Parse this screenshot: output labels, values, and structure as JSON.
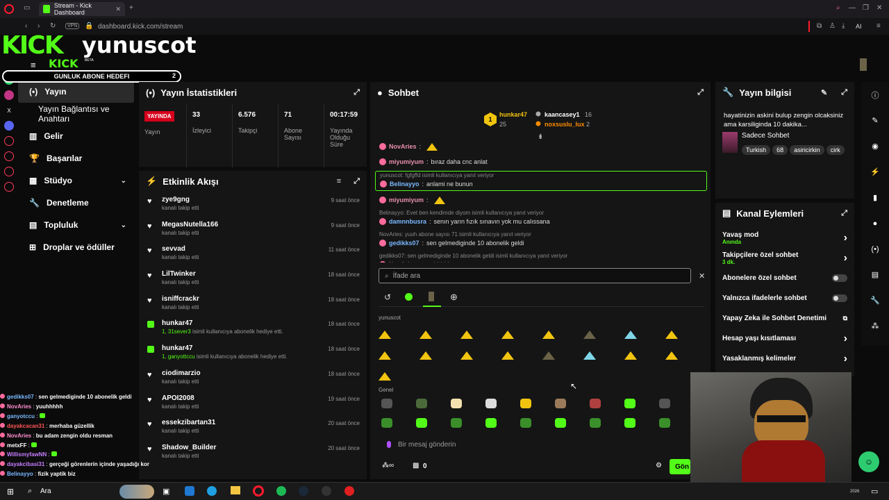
{
  "browser": {
    "tab_title": "Stream - Kick Dashboard",
    "new_tab": "+",
    "vpn": "VPN",
    "url": "dashboard.kick.com/stream",
    "ai_label": "AI"
  },
  "overlay": {
    "logo": "KICK",
    "logo_small": "KICK",
    "beta": "BETA",
    "username": "yunuscot",
    "goal_label": "GUNLUK ABONE HEDEFI",
    "goal_count": "2"
  },
  "nav": {
    "items": [
      {
        "label": "Yayın",
        "icon": "broadcast-icon"
      },
      {
        "label": "Yayın Bağlantısı ve Anahtarı",
        "icon": ""
      },
      {
        "label": "Gelir",
        "icon": "chart-icon"
      },
      {
        "label": "Başarılar",
        "icon": "trophy-icon"
      },
      {
        "label": "Stüdyo",
        "icon": "studio-icon"
      },
      {
        "label": "Denetleme",
        "icon": "wrench-icon"
      },
      {
        "label": "Topluluk",
        "icon": "community-icon"
      },
      {
        "label": "Droplar ve ödüller",
        "icon": "drops-icon"
      }
    ]
  },
  "stats": {
    "title": "Yayın İstatistikleri",
    "live_badge": "YAYINDA",
    "live_label": "Yayın",
    "cells": [
      {
        "value": "33",
        "label": "İzleyici"
      },
      {
        "value": "6.576",
        "label": "Takipçi"
      },
      {
        "value": "71",
        "label": "Abone Sayısı"
      },
      {
        "value": "00:17:59",
        "label": "Yayında Olduğu Süre"
      }
    ]
  },
  "activity": {
    "title": "Etkinlik Akışı",
    "items": [
      {
        "name": "zye9gng",
        "action": "kanalı takip etti",
        "time": "9 saat önce",
        "type": "follow"
      },
      {
        "name": "MegasNutella166",
        "action": "kanalı takip etti",
        "time": "9 saat önce",
        "type": "follow"
      },
      {
        "name": "sevvad",
        "action": "kanalı takip etti",
        "time": "11 saat önce",
        "type": "follow"
      },
      {
        "name": "LilTwinker",
        "action": "kanalı takip etti",
        "time": "18 saat önce",
        "type": "follow"
      },
      {
        "name": "isniffcrackr",
        "action": "kanalı takip etti",
        "time": "18 saat önce",
        "type": "follow"
      },
      {
        "name": "hunkar47",
        "gift_target": "1, 31sever3",
        "action": "isimli kullanıcıya abonelik hediye etti.",
        "time": "18 saat önce",
        "type": "gift"
      },
      {
        "name": "hunkar47",
        "gift_target": "1, ganyottccu",
        "action": "isimli kullanıcıya abonelik hediye etti.",
        "time": "18 saat önce",
        "type": "gift"
      },
      {
        "name": "ciodimarzio",
        "action": "kanalı takip etti",
        "time": "18 saat önce",
        "type": "follow"
      },
      {
        "name": "APOI2008",
        "action": "kanalı takip etti",
        "time": "19 saat önce",
        "type": "follow"
      },
      {
        "name": "essekzibartan31",
        "action": "kanalı takip etti",
        "time": "20 saat önce",
        "type": "follow"
      },
      {
        "name": "Shadow_Builder",
        "action": "kanalı takip etti",
        "time": "20 saat önce",
        "type": "follow"
      }
    ]
  },
  "chat": {
    "title": "Sohbet",
    "top_gifters": [
      {
        "rank": "1",
        "name": "hunkar47",
        "count": "25"
      },
      {
        "name": "kaancasey1",
        "count": "16"
      },
      {
        "name": "noxsuslu_lux",
        "count": "2"
      }
    ],
    "messages": [
      {
        "user": "NovAries",
        "text": "",
        "color": "#e88fb0",
        "reply": ""
      },
      {
        "user": "miyumiyum",
        "text": "bıraz daha cnc anlat",
        "color": "#e88fb0",
        "reply": ""
      },
      {
        "user": "Belinayyo",
        "text": "anlami ne bunun",
        "color": "#7ab8ff",
        "reply": "yunuscot: fgfgffd isimli kullanıcıya yanıt veriyor",
        "highlight": true
      },
      {
        "user": "miyumiyum",
        "text": "",
        "color": "#e88fb0",
        "reply": ""
      },
      {
        "user": "damnnbusra",
        "text": "senın yarın fızık sınavın yok mu calıssana",
        "color": "#7ab8ff",
        "reply": "Belinayyo: Evet ben kendimde diyom isimli kullanıcıya yanıt veriyor"
      },
      {
        "user": "gedikks07",
        "text": "sen gelmediginde 10 abonelik geldi",
        "color": "#7ab8ff",
        "reply": "NovAries: yuuh abone sayısı 71 isimli kullanıcıya yanıt veriyor"
      },
      {
        "user": "NovAries",
        "text": "yuuhhhhh",
        "color": "#e88fb0",
        "reply": "gedikks07: sen gelmediginde 10 abonelik geldi isimli kullanıcıya yanıt veriyor"
      }
    ],
    "emote_search_placeholder": "İfade ara",
    "section_channel": "yunuscot",
    "section_general": "Genel",
    "input_placeholder": "Bir mesaj gönderin",
    "points": "0",
    "send_label": "Gön"
  },
  "info": {
    "title": "Yayın bilgisi",
    "stream_title": "hayatinizin askini bulup zengin olcaksiniz ama karsiliginda 10 dakika...",
    "category": "Sadece Sohbet",
    "tags": [
      "Turkish",
      "68",
      "asiricirkin",
      "cirk"
    ]
  },
  "actions": {
    "title": "Kanal Eylemleri",
    "rows": [
      {
        "label": "Yavaş mod",
        "sub": "Anında",
        "control": "arrow"
      },
      {
        "label": "Takipçilere özel sohbet",
        "sub": "3 dk.",
        "control": "arrow"
      },
      {
        "label": "Abonelere özel sohbet",
        "sub": "",
        "control": "toggle"
      },
      {
        "label": "Yalnızca ifadelerle sohbet",
        "sub": "",
        "control": "toggle"
      },
      {
        "label": "Yapay Zeka ile Sohbet Denetimi",
        "sub": "",
        "control": "external"
      },
      {
        "label": "Hesap yaşı kısıtlaması",
        "sub": "",
        "control": "arrow"
      },
      {
        "label": "Yasaklanmış kelimeler",
        "sub": "",
        "control": "arrow"
      }
    ]
  },
  "overlay_chat": [
    {
      "user": "gedikks07",
      "text": "sen gelmediginde 10 abonelik geldi",
      "color": "#7ab8ff"
    },
    {
      "user": "NovAries",
      "text": "yuuhhhhh",
      "color": "#ff8fcf"
    },
    {
      "user": "ganyotccu",
      "text": "",
      "color": "#7ab8ff"
    },
    {
      "user": "dayakcacan31",
      "text": "merhaba güzellik",
      "color": "#ff5555"
    },
    {
      "user": "NovAries",
      "text": "bu adam zengin oldu resman",
      "color": "#ff8fcf"
    },
    {
      "user": "metxFF",
      "text": "",
      "color": "#ffffff"
    },
    {
      "user": "WillismyfawNN",
      "text": "",
      "color": "#c77dff"
    },
    {
      "user": "dayakcibasi31",
      "text": "gerçeği görenlerin içinde yaşadığı korkunç çaresizlig sensin abi",
      "color": "#c77dff"
    },
    {
      "user": "Belinayyo",
      "text": "fizik yaptik biz",
      "color": "#7ab8ff"
    }
  ],
  "taskbar": {
    "search": "Ara",
    "year": "2026"
  },
  "colors": {
    "accent": "#53fc18",
    "live": "#d6001c",
    "panel": "#151515",
    "background": "#0b0b0b"
  }
}
